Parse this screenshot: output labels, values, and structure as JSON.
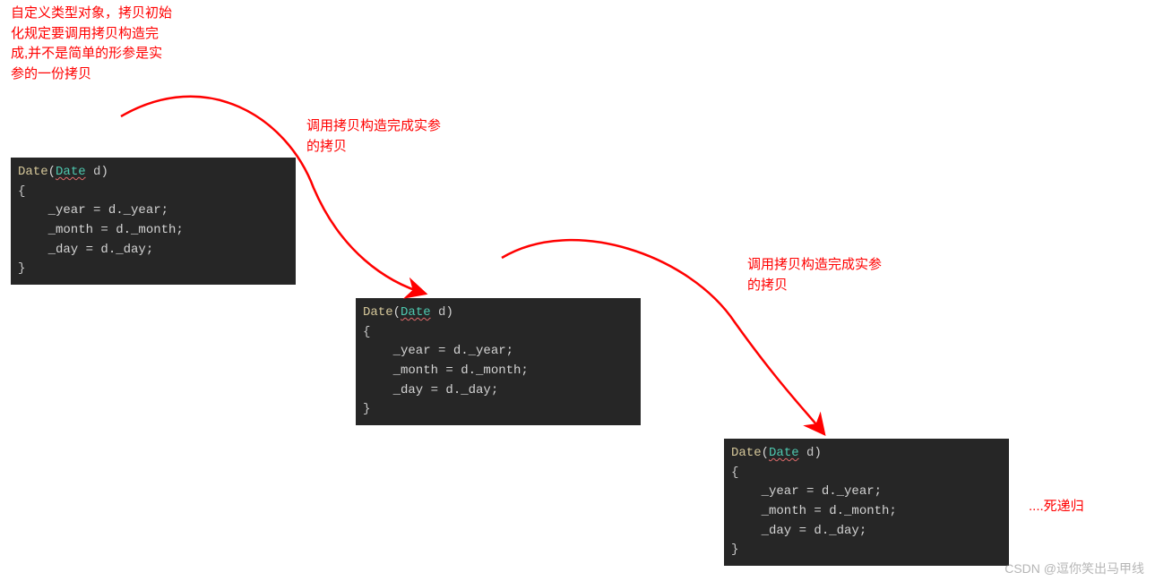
{
  "annotations": {
    "top_left": "自定义类型对象，拷贝初始\n化规定要调用拷贝构造完\n成,并不是简单的形参是实\n参的一份拷贝",
    "mid": "调用拷贝构造完成实参\n的拷贝",
    "right": "调用拷贝构造完成实参\n的拷贝",
    "ellipsis": "....死递归"
  },
  "code": {
    "sig_type": "Date",
    "sig_open": "(",
    "sig_param_type": "Date",
    "sig_param_name": " d",
    "sig_close": ")",
    "brace_open": "{",
    "l1": "    _year = d._year;",
    "l2": "    _month = d._month;",
    "l3": "    _day = d._day;",
    "brace_close": "}"
  },
  "watermark": "CSDN @逗你笑出马甲线",
  "colors": {
    "annotation": "#ff0000",
    "code_bg": "#262626",
    "type1": "#d6c89a",
    "type2": "#4ec9b0"
  }
}
